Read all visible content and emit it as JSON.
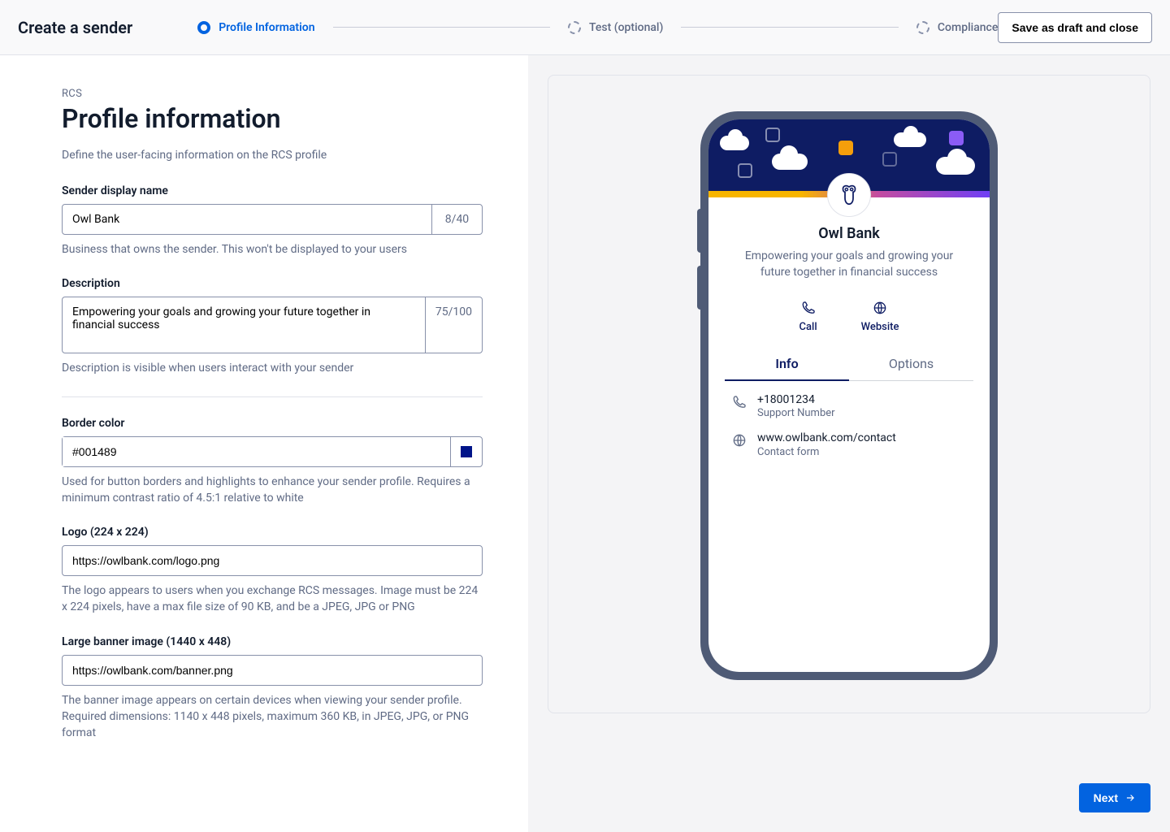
{
  "header": {
    "title": "Create a sender",
    "steps": [
      "Profile Information",
      "Test (optional)",
      "Compliance"
    ],
    "save": "Save as draft and close"
  },
  "page": {
    "eyebrow": "RCS",
    "title": "Profile information",
    "subtitle": "Define the user-facing information on the RCS profile"
  },
  "form": {
    "display_name": {
      "label": "Sender display name",
      "value": "Owl Bank",
      "counter": "8/40",
      "help": "Business that owns the sender. This won't be displayed to your users"
    },
    "description": {
      "label": "Description",
      "value": "Empowering your goals and growing your future together in financial success",
      "counter": "75/100",
      "help": "Description is visible when users interact with your sender"
    },
    "border_color": {
      "label": "Border color",
      "value": "#001489",
      "help": "Used for button borders and highlights to enhance your sender profile. Requires a minimum contrast ratio of 4.5:1 relative to white"
    },
    "logo": {
      "label": "Logo (224 x 224)",
      "value": "https://owlbank.com/logo.png",
      "help": "The logo appears to users when you exchange RCS messages. Image must be 224 x 224 pixels, have a max file size of 90 KB, and be a JPEG, JPG or PNG"
    },
    "banner": {
      "label": "Large banner image (1440 x 448)",
      "value": "https://owlbank.com/banner.png",
      "help": "The banner image appears on certain devices when viewing your sender profile. Required dimensions: 1140 x 448 pixels, maximum 360 KB, in JPEG, JPG, or PNG format"
    }
  },
  "preview": {
    "name": "Owl Bank",
    "description": "Empowering your goals and growing your future together in financial success",
    "actions": {
      "call": "Call",
      "website": "Website"
    },
    "tabs": {
      "info": "Info",
      "options": "Options"
    },
    "info": {
      "phone": {
        "value": "+18001234",
        "label": "Support Number"
      },
      "web": {
        "value": "www.owlbank.com/contact",
        "label": "Contact form"
      }
    }
  },
  "footer": {
    "next": "Next"
  }
}
